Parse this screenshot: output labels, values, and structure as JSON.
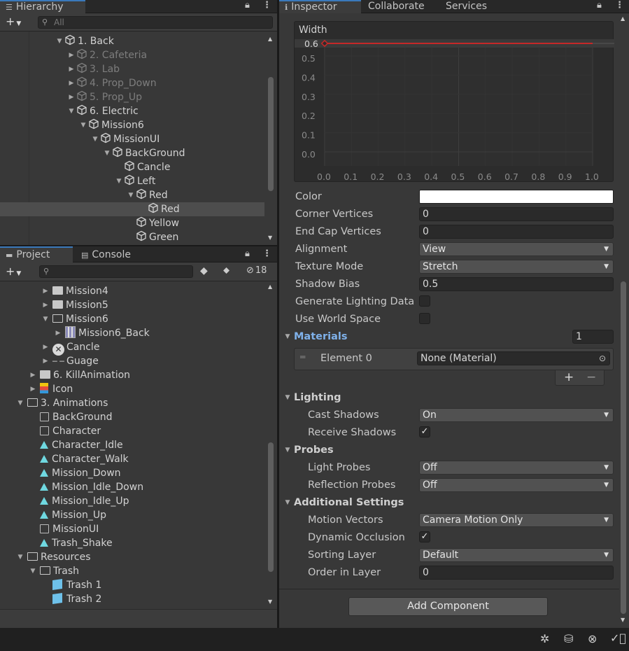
{
  "hierarchy": {
    "tab_label": "Hierarchy",
    "search_placeholder": "All",
    "items": [
      {
        "label": "1. Back",
        "dim": false,
        "depth": 0,
        "arrow": "▼"
      },
      {
        "label": "2. Cafeteria",
        "dim": true,
        "depth": 1,
        "arrow": "▶"
      },
      {
        "label": "3. Lab",
        "dim": true,
        "depth": 1,
        "arrow": "▶"
      },
      {
        "label": "4. Prop_Down",
        "dim": true,
        "depth": 1,
        "arrow": "▶"
      },
      {
        "label": "5. Prop_Up",
        "dim": true,
        "depth": 1,
        "arrow": "▶"
      },
      {
        "label": "6. Electric",
        "dim": false,
        "depth": 1,
        "arrow": "▼"
      },
      {
        "label": "Mission6",
        "dim": false,
        "depth": 2,
        "arrow": "▼"
      },
      {
        "label": "MissionUI",
        "dim": false,
        "depth": 3,
        "arrow": "▼"
      },
      {
        "label": "BackGround",
        "dim": false,
        "depth": 4,
        "arrow": "▼"
      },
      {
        "label": "Cancle",
        "dim": false,
        "depth": 5,
        "arrow": ""
      },
      {
        "label": "Left",
        "dim": false,
        "depth": 5,
        "arrow": "▼"
      },
      {
        "label": "Red",
        "dim": false,
        "depth": 6,
        "arrow": "▼"
      },
      {
        "label": "Red",
        "dim": false,
        "depth": 7,
        "arrow": "",
        "selected": true
      },
      {
        "label": "Yellow",
        "dim": false,
        "depth": 6,
        "arrow": ""
      },
      {
        "label": "Green",
        "dim": false,
        "depth": 6,
        "arrow": ""
      }
    ]
  },
  "project": {
    "tab_label": "Project",
    "console_label": "Console",
    "hidden_count": "18",
    "items": [
      {
        "label": "Mission4",
        "depth": 2,
        "arrow": "▶",
        "icon": "folder"
      },
      {
        "label": "Mission5",
        "depth": 2,
        "arrow": "▶",
        "icon": "folder"
      },
      {
        "label": "Mission6",
        "depth": 2,
        "arrow": "▼",
        "icon": "folder-open"
      },
      {
        "label": "Mission6_Back",
        "depth": 3,
        "arrow": "▶",
        "icon": "sprite"
      },
      {
        "label": "Cancle",
        "depth": 2,
        "arrow": "▶",
        "icon": "x-sprite"
      },
      {
        "label": "Guage",
        "depth": 2,
        "arrow": "▶",
        "icon": "line"
      },
      {
        "label": "6. KillAnimation",
        "depth": 1,
        "arrow": "▶",
        "icon": "folder"
      },
      {
        "label": "Icon",
        "depth": 1,
        "arrow": "▶",
        "icon": "character"
      },
      {
        "label": "3. Animations",
        "depth": 0,
        "arrow": "▼",
        "icon": "folder-open"
      },
      {
        "label": "BackGround",
        "depth": 1,
        "arrow": "",
        "icon": "controller"
      },
      {
        "label": "Character",
        "depth": 1,
        "arrow": "",
        "icon": "controller"
      },
      {
        "label": "Character_Idle",
        "depth": 1,
        "arrow": "",
        "icon": "anim"
      },
      {
        "label": "Character_Walk",
        "depth": 1,
        "arrow": "",
        "icon": "anim"
      },
      {
        "label": "Mission_Down",
        "depth": 1,
        "arrow": "",
        "icon": "anim"
      },
      {
        "label": "Mission_Idle_Down",
        "depth": 1,
        "arrow": "",
        "icon": "anim"
      },
      {
        "label": "Mission_Idle_Up",
        "depth": 1,
        "arrow": "",
        "icon": "anim"
      },
      {
        "label": "Mission_Up",
        "depth": 1,
        "arrow": "",
        "icon": "anim"
      },
      {
        "label": "MissionUI",
        "depth": 1,
        "arrow": "",
        "icon": "controller"
      },
      {
        "label": "Trash_Shake",
        "depth": 1,
        "arrow": "",
        "icon": "anim"
      },
      {
        "label": "Resources",
        "depth": 0,
        "arrow": "▼",
        "icon": "folder-open"
      },
      {
        "label": "Trash",
        "depth": 1,
        "arrow": "▼",
        "icon": "folder-open"
      },
      {
        "label": "Trash 1",
        "depth": 2,
        "arrow": "",
        "icon": "prefab"
      },
      {
        "label": "Trash 2",
        "depth": 2,
        "arrow": "",
        "icon": "prefab"
      }
    ]
  },
  "inspector": {
    "tabs": {
      "inspector": "Inspector",
      "collaborate": "Collaborate",
      "services": "Services"
    },
    "curve": {
      "title": "Width",
      "value_label": "0.6",
      "y_ticks": [
        "0.5",
        "0.4",
        "0.3",
        "0.2",
        "0.1",
        "0.0"
      ],
      "x_ticks": [
        "0.0",
        "0.1",
        "0.2",
        "0.3",
        "0.4",
        "0.5",
        "0.6",
        "0.7",
        "0.8",
        "0.9",
        "1.0"
      ],
      "line_color": "#c62828"
    },
    "props": {
      "color_label": "Color",
      "corner_label": "Corner Vertices",
      "corner_value": "0",
      "endcap_label": "End Cap Vertices",
      "endcap_value": "0",
      "alignment_label": "Alignment",
      "alignment_value": "View",
      "texture_label": "Texture Mode",
      "texture_value": "Stretch",
      "shadow_bias_label": "Shadow Bias",
      "shadow_bias_value": "0.5",
      "gen_lighting_label": "Generate Lighting Data",
      "world_space_label": "Use World Space"
    },
    "materials": {
      "label": "Materials",
      "size": "1",
      "element_label": "Element 0",
      "element_value": "None (Material)",
      "add": "+",
      "remove": "−"
    },
    "lighting": {
      "label": "Lighting",
      "cast_label": "Cast Shadows",
      "cast_value": "On",
      "receive_label": "Receive Shadows"
    },
    "probes": {
      "label": "Probes",
      "light_label": "Light Probes",
      "light_value": "Off",
      "reflection_label": "Reflection Probes",
      "reflection_value": "Off"
    },
    "additional": {
      "label": "Additional Settings",
      "motion_label": "Motion Vectors",
      "motion_value": "Camera Motion Only",
      "occlusion_label": "Dynamic Occlusion",
      "sorting_label": "Sorting Layer",
      "sorting_value": "Default",
      "order_label": "Order in Layer",
      "order_value": "0"
    },
    "add_component": "Add Component"
  }
}
